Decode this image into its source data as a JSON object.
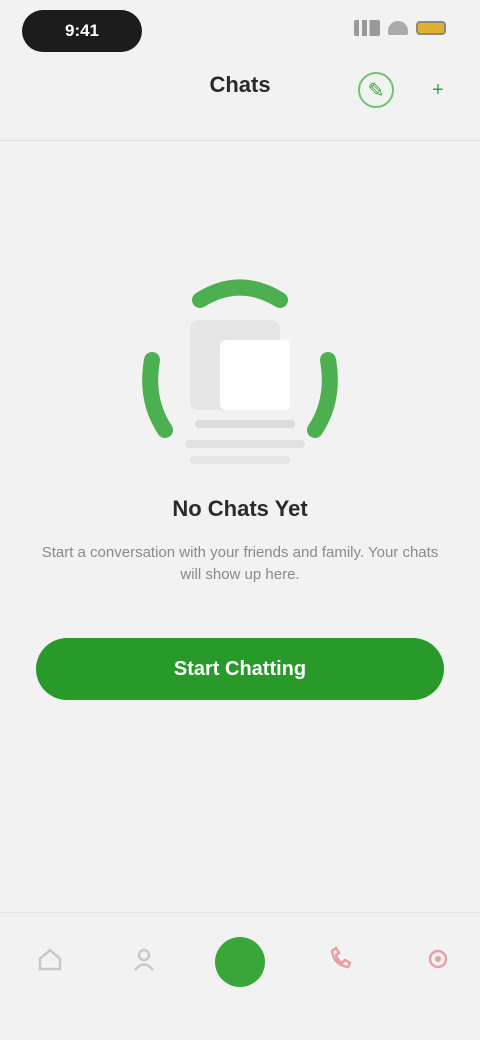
{
  "status_bar": {
    "time": "9:41",
    "icons": [
      "signal-icon",
      "wifi-icon",
      "battery-icon"
    ]
  },
  "header": {
    "title": "Chats",
    "subtitle": "",
    "buttons": [
      {
        "icon": "compose-icon"
      },
      {
        "icon": "add-icon"
      }
    ]
  },
  "empty_state": {
    "title": "No Chats Yet",
    "description": "Start a conversation with your friends and family. Your chats will show up here.",
    "cta_label": "Start Chatting"
  },
  "tab_bar": {
    "tabs": [
      {
        "icon": "home-icon",
        "label": ""
      },
      {
        "icon": "contacts-icon",
        "label": ""
      },
      {
        "icon": "chats-icon",
        "label": "",
        "active": true
      },
      {
        "icon": "calls-icon",
        "label": ""
      },
      {
        "icon": "settings-icon",
        "label": ""
      }
    ]
  },
  "colors": {
    "accent": "#279a2a",
    "background": "#f2f2f2",
    "text_primary": "#2a2a2a",
    "text_secondary": "#8a8a8a"
  }
}
